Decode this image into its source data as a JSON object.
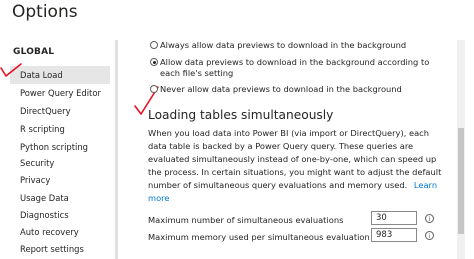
{
  "window": {
    "title": "Options"
  },
  "sidebar": {
    "section": "GLOBAL",
    "items": [
      {
        "label": "Data Load"
      },
      {
        "label": "Power Query Editor"
      },
      {
        "label": "DirectQuery"
      },
      {
        "label": "R scripting"
      },
      {
        "label": "Python scripting"
      },
      {
        "label": "Security"
      },
      {
        "label": "Privacy"
      },
      {
        "label": "Usage Data"
      },
      {
        "label": "Diagnostics"
      },
      {
        "label": "Auto recovery"
      },
      {
        "label": "Report settings"
      }
    ],
    "active_index": 0
  },
  "data_previews": {
    "options": [
      {
        "label": "Always allow data previews to download in the background",
        "selected": false
      },
      {
        "label": "Allow data previews to download in the background according to each file's setting",
        "selected": true
      },
      {
        "label": "Never allow data previews to download in the background",
        "selected": false
      }
    ]
  },
  "loading": {
    "heading": "Loading tables simultaneously",
    "description": "When you load data into Power BI (via import or DirectQuery), each data table is backed by a Power Query query. These queries are evaluated simultaneously instead of one-by-one, which can speed up the process. In certain situations, you might want to adjust the default number of simultaneous query evaluations and memory used.",
    "learn_more": "Learn more",
    "max_evaluations": {
      "label": "Maximum number of simultaneous evaluations",
      "value": "30"
    },
    "max_memory": {
      "label": "Maximum memory used per simultaneous evaluation (MB)",
      "value": "983"
    }
  },
  "colors": {
    "accent": "#0078d4",
    "annotation": "#e81123",
    "active_item": "#e6e6e6"
  },
  "icons": {
    "info": "info-icon"
  }
}
